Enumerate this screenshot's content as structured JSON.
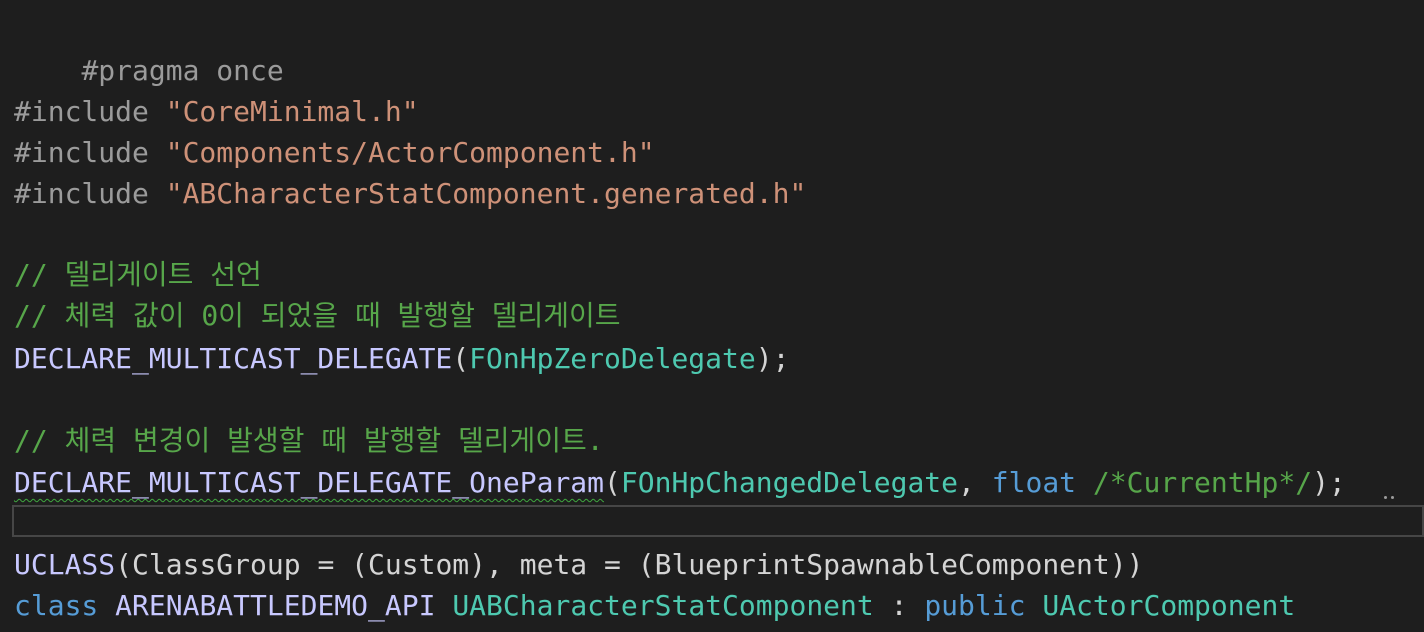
{
  "lines": {
    "l1": {
      "text": "#pragma once"
    },
    "l3": {
      "pre": "#include ",
      "str": "\"CoreMinimal.h\""
    },
    "l4": {
      "pre": "#include ",
      "str": "\"Components/ActorComponent.h\""
    },
    "l5": {
      "pre": "#include ",
      "str": "\"ABCharacterStatComponent.generated.h\""
    },
    "l7": {
      "text": "// 델리게이트 선언"
    },
    "l8": {
      "text": "// 체력 값이 0이 되었을 때 발행할 델리게이트"
    },
    "l9": {
      "macro": "DECLARE_MULTICAST_DELEGATE",
      "open": "(",
      "type": "FOnHpZeroDelegate",
      "close": ");"
    },
    "l11": {
      "text": "// 체력 변경이 발생할 때 발행할 델리게이트."
    },
    "l12": {
      "macro": "DECLARE_MULTICAST_DELEGATE_OneParam",
      "open": "(",
      "type": "FOnHpChangedDelegate",
      "sep": ", ",
      "kw": "float",
      "space": " ",
      "comment": "/*CurrentHp*/",
      "close": ");"
    },
    "l14": {
      "macro": "UCLASS",
      "rest": "(ClassGroup = (Custom), meta = (BlueprintSpawnableComponent))"
    },
    "l15": {
      "kw": "class",
      "api": "ARENABATTLEDEMO_API",
      "cls": "UABCharacterStatComponent",
      "colon": " : ",
      "pub": "public",
      "base": "UActorComponent"
    }
  }
}
